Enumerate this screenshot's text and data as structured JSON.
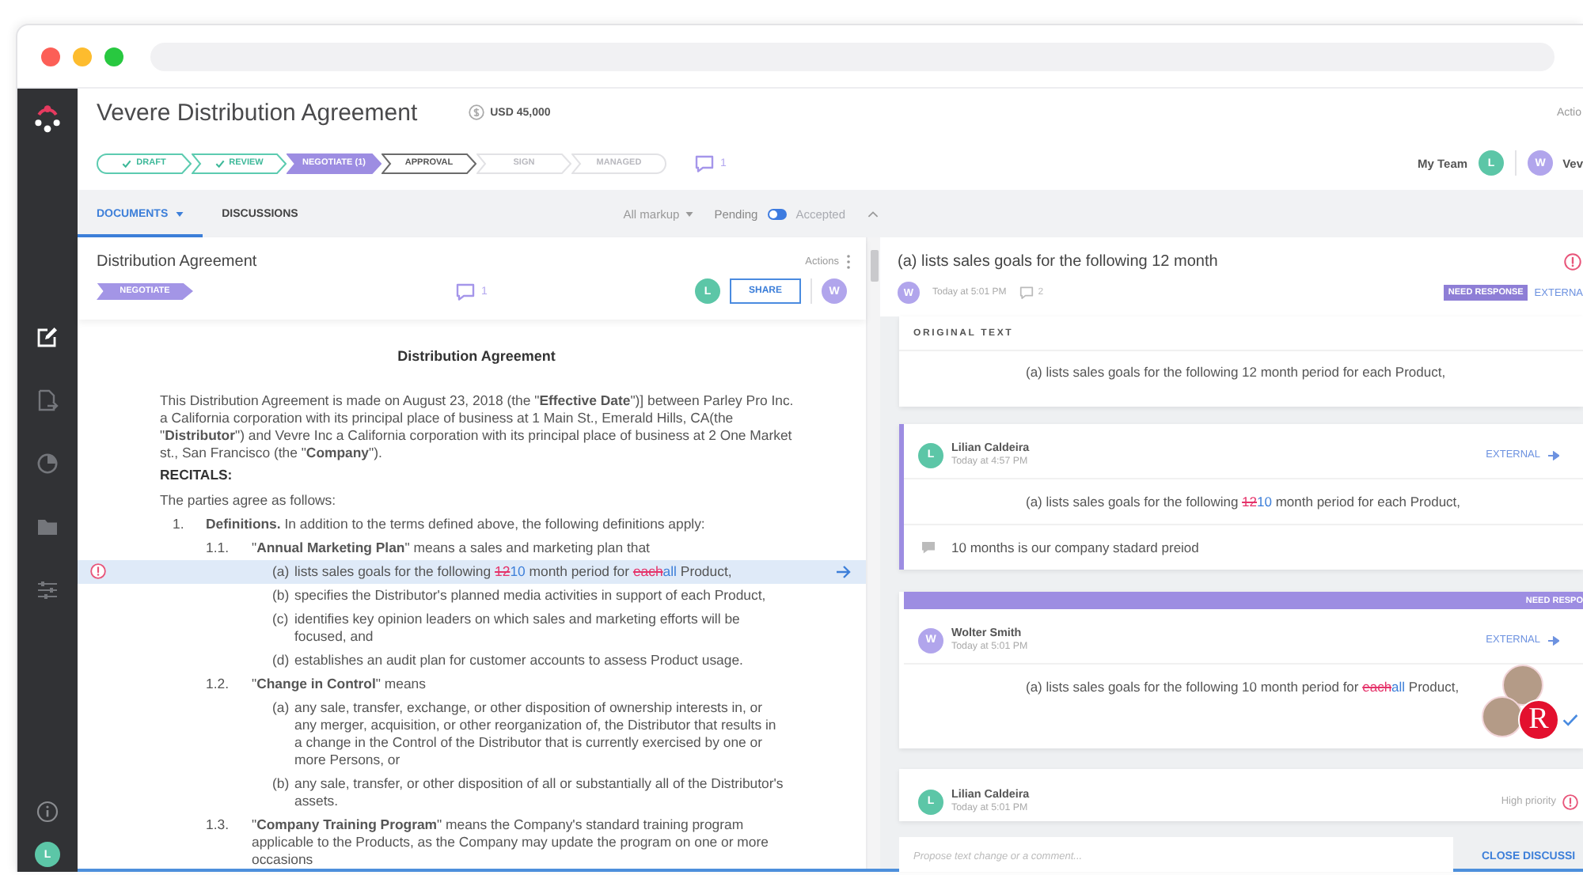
{
  "sidebar": {
    "items": [
      {
        "selected": true
      },
      {
        "selected": false
      },
      {
        "selected": false
      },
      {
        "selected": false
      },
      {
        "selected": false
      }
    ],
    "user": {
      "initial": "L",
      "color": "#5cc6a7"
    }
  },
  "header": {
    "title": "Vevere Distribution Agreement",
    "amount": "USD 45,000",
    "actions": "Actio"
  },
  "stages": {
    "steps": [
      {
        "label": "DRAFT",
        "done": true,
        "selected": false,
        "disabled": false
      },
      {
        "label": "REVIEW",
        "done": true,
        "selected": false,
        "disabled": false
      },
      {
        "label": "NEGOTIATE (1)",
        "done": false,
        "selected": true,
        "disabled": false
      },
      {
        "label": "APPROVAL",
        "done": false,
        "selected": false,
        "disabled": false
      },
      {
        "label": "SIGN",
        "done": false,
        "selected": false,
        "disabled": true
      },
      {
        "label": "MANAGED",
        "done": false,
        "selected": false,
        "disabled": true
      }
    ],
    "comments": "1"
  },
  "team": {
    "label": "My Team",
    "member": {
      "initial": "L",
      "color": "#5cc6a7"
    },
    "counterparty": {
      "initial": "W",
      "color": "#b1a5ec",
      "name": "Vev"
    }
  },
  "tabs": [
    {
      "label": "DOCUMENTS",
      "selected": true,
      "dropdown": true
    },
    {
      "label": "DISCUSSIONS",
      "selected": false,
      "dropdown": false
    }
  ],
  "filters": {
    "markup": "All markup",
    "pending": "Pending",
    "accepted": "Accepted",
    "show_accepted": false
  },
  "document": {
    "title": "Distribution Agreement",
    "actions": "Actions",
    "stage": "NEGOTIATE",
    "comments": "1",
    "owner": {
      "initial": "L",
      "color": "#5cc6a7"
    },
    "share": "SHARE",
    "counterparty": {
      "initial": "W",
      "color": "#b1a5ec"
    },
    "heading": "Distribution Agreement",
    "intro": "This Distribution Agreement is made on August 23, 2018 (the \"**Effective Date**\")] between Parley Pro Inc. a California corporation with its principal place of business at 1 Main St., Emerald Hills, CA(the \"**Distributor**\") and Vevre Inc a California corporation with its principal place of business at 2 One Market st., San Francisco (the \"**Company**\").",
    "recitals": "RECITALS:",
    "lead": "The parties agree as follows:",
    "clauses": [
      {
        "number": "1.",
        "text": "**Definitions.** In addition to the terms defined above, the following definitions apply:",
        "selected": false,
        "children": [
          {
            "number": "1.1.",
            "text": "\"**Annual Marketing Plan**\" means a sales and marketing plan that",
            "selected": false,
            "children": [
              {
                "number": "(a)",
                "segments": [
                  {
                    "kind": "plain",
                    "text": "lists sales goals for the following "
                  },
                  {
                    "kind": "deleted",
                    "text": "12"
                  },
                  {
                    "kind": "inserted",
                    "text": "10"
                  },
                  {
                    "kind": "plain",
                    "text": " month period for "
                  },
                  {
                    "kind": "deleted",
                    "text": "each"
                  },
                  {
                    "kind": "inserted",
                    "text": "all"
                  },
                  {
                    "kind": "plain",
                    "text": " Product,"
                  }
                ],
                "selected": true
              },
              {
                "number": "(b)",
                "text": "specifies the Distributor's planned media activities in support of each Product,",
                "selected": false
              },
              {
                "number": "(c)",
                "text": "identifies key opinion leaders on which sales and marketing efforts will be focused, and",
                "selected": false
              },
              {
                "number": "(d)",
                "text": "establishes an audit plan for customer accounts to assess Product usage.",
                "selected": false
              }
            ]
          },
          {
            "number": "1.2.",
            "text": "\"**Change in Control**\" means",
            "selected": false,
            "children": [
              {
                "number": "(a)",
                "text": "any sale, transfer, exchange, or other disposition of ownership interests in, or any merger, acquisition, or other reorganization of, the Distributor that results in a change in the Control of the Distributor that is currently exercised by one or more Persons, or",
                "selected": false
              },
              {
                "number": "(b)",
                "text": "any sale, transfer, or other disposition of all or substantially all of the Distributor's assets.",
                "selected": false
              }
            ]
          },
          {
            "number": "1.3.",
            "text": "\"**Company Training Program**\" means the Company's standard training program applicable to the Products, as the Company may update the program on one or more occasions",
            "selected": false
          }
        ]
      }
    ]
  },
  "discussion": {
    "title": "(a) lists sales goals for the following 12 month",
    "alert": true,
    "author": {
      "initial": "W",
      "color": "#b1a5ec"
    },
    "time": "Today at 5:01 PM",
    "comments": "2",
    "status": "NEED RESPONSE",
    "visibility": "EXTERNA",
    "original": {
      "label": "ORIGINAL TEXT",
      "text": "(a) lists sales goals for the following 12 month period for each Product,"
    },
    "entries": [
      {
        "kind": "proposal",
        "selected": true,
        "approved": false,
        "author": {
          "name": "Lilian Caldeira",
          "initial": "L",
          "color": "#5cc6a7"
        },
        "time": "Today at 4:57 PM",
        "visibility": "EXTERNAL",
        "segments": [
          {
            "kind": "plain",
            "text": "(a) lists sales goals for the following "
          },
          {
            "kind": "deleted",
            "text": "12"
          },
          {
            "kind": "inserted",
            "text": "10"
          },
          {
            "kind": "plain",
            "text": " month period for each Product,"
          }
        ],
        "comment": "10 months is our company stadard preiod"
      },
      {
        "kind": "proposal",
        "selected": false,
        "approved": true,
        "banner": "NEED RESPO",
        "author": {
          "name": "Wolter Smith",
          "initial": "W",
          "color": "#b1a5ec"
        },
        "time": "Today at 5:01 PM",
        "visibility": "EXTERNAL",
        "segments": [
          {
            "kind": "plain",
            "text": "(a) lists sales goals for the following 10 month period for "
          },
          {
            "kind": "deleted",
            "text": "each"
          },
          {
            "kind": "inserted",
            "text": "all"
          },
          {
            "kind": "plain",
            "text": " Product,"
          }
        ]
      },
      {
        "kind": "collapsed",
        "selected": false,
        "approved": false,
        "author": {
          "name": "Lilian Caldeira",
          "initial": "L",
          "color": "#5cc6a7"
        },
        "time": "Today at 5:01 PM",
        "priority": "High priority"
      }
    ],
    "composer": {
      "placeholder": "Propose text change or a comment...",
      "close": "CLOSE DISCUSSI"
    }
  },
  "chat_widget": {
    "avatars": [
      {
        "kind": "photo"
      },
      {
        "kind": "photo"
      },
      {
        "kind": "letter",
        "text": "R"
      }
    ]
  }
}
